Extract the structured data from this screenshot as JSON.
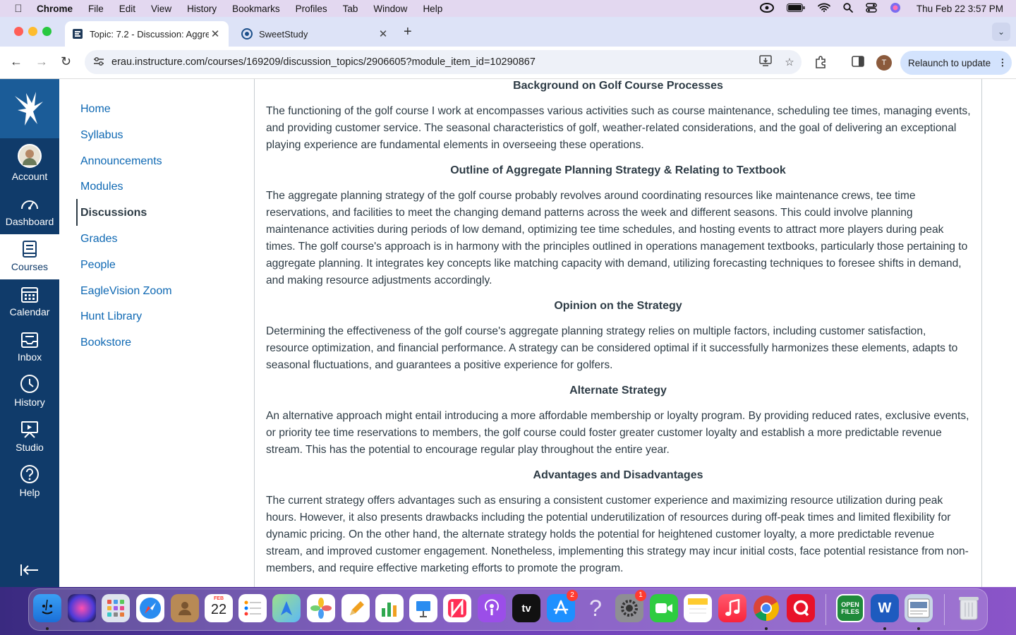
{
  "menubar": {
    "app_name": "Chrome",
    "items": [
      "File",
      "Edit",
      "View",
      "History",
      "Bookmarks",
      "Profiles",
      "Tab",
      "Window",
      "Help"
    ],
    "clock": "Thu Feb 22  3:57 PM"
  },
  "tabs": [
    {
      "title": "Topic: 7.2 - Discussion: Aggre",
      "favicon": "canvas-icon"
    },
    {
      "title": "SweetStudy",
      "favicon": "sweetstudy-icon"
    }
  ],
  "toolbar": {
    "url": "erau.instructure.com/courses/169209/discussion_topics/2906605?module_item_id=10290867",
    "profile_initial": "T",
    "relaunch_label": "Relaunch to update"
  },
  "global_nav": {
    "items": [
      {
        "label": "Account",
        "icon": "avatar-icon"
      },
      {
        "label": "Dashboard",
        "icon": "dashboard-icon"
      },
      {
        "label": "Courses",
        "icon": "courses-icon"
      },
      {
        "label": "Calendar",
        "icon": "calendar-icon"
      },
      {
        "label": "Inbox",
        "icon": "inbox-icon"
      },
      {
        "label": "History",
        "icon": "history-icon"
      },
      {
        "label": "Studio",
        "icon": "studio-icon"
      },
      {
        "label": "Help",
        "icon": "help-icon"
      }
    ],
    "active": "Courses"
  },
  "course_nav": {
    "items": [
      "Home",
      "Syllabus",
      "Announcements",
      "Modules",
      "Discussions",
      "Grades",
      "People",
      "EagleVision Zoom",
      "Hunt Library",
      "Bookstore"
    ],
    "active": "Discussions"
  },
  "content": {
    "h1": "Background on Golf Course Processes",
    "p1": "The functioning of the golf course I work at encompasses various activities such as course maintenance, scheduling tee times, managing events, and providing customer service. The seasonal characteristics of golf, weather-related considerations, and the goal of delivering an exceptional playing experience are fundamental elements in overseeing these operations.",
    "h2": "Outline of Aggregate Planning Strategy & Relating to Textbook",
    "p2": "The aggregate planning strategy of the golf course probably revolves around coordinating resources like maintenance crews, tee time reservations, and facilities to meet the changing demand patterns across the week and different seasons. This could involve planning maintenance activities during periods of low demand, optimizing tee time schedules, and hosting events to attract more players during peak times. The golf course's approach is in harmony with the principles outlined in operations management textbooks, particularly those pertaining to aggregate planning. It integrates key concepts like matching capacity with demand, utilizing forecasting techniques to foresee shifts in demand, and making resource adjustments accordingly.",
    "h3": "Opinion on the Strategy",
    "p3": "Determining the effectiveness of the golf course's aggregate planning strategy relies on multiple factors, including customer satisfaction, resource optimization, and financial performance. A strategy can be considered optimal if it successfully harmonizes these elements, adapts to seasonal fluctuations, and guarantees a positive experience for golfers.",
    "h4": "Alternate Strategy",
    "p4": "An alternative approach might entail introducing a more affordable membership or loyalty program. By providing reduced rates, exclusive events, or priority tee time reservations to members, the golf course could foster greater customer loyalty and establish a more predictable revenue stream. This has the potential to encourage regular play throughout the entire year.",
    "h5": "Advantages and Disadvantages",
    "p5": "The current strategy offers advantages such as ensuring a consistent customer experience and maximizing resource utilization during peak hours. However, it also presents drawbacks including the potential underutilization of resources during off-peak times and limited flexibility for dynamic pricing. On the other hand, the alternate strategy holds the potential for heightened customer loyalty, a more predictable revenue stream, and improved customer engagement. Nonetheless, implementing this strategy may incur initial costs, face potential resistance from non-members, and require effective marketing efforts to promote the program."
  },
  "dock": {
    "calendar_month": "FEB",
    "calendar_day": "22",
    "appstore_badge": "2",
    "settings_badge": "1",
    "openfiles_label": "OPEN FILES",
    "word_label": "W",
    "tv_label": "tv",
    "help_glyph": "?"
  }
}
